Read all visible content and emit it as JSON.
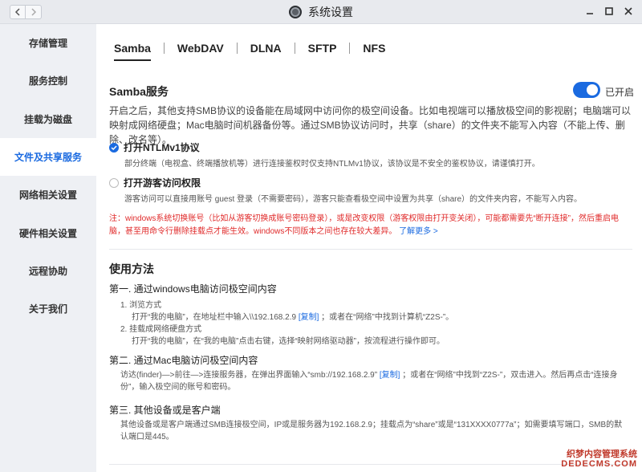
{
  "window": {
    "title": "系统设置"
  },
  "sidebar": {
    "items": [
      {
        "label": "存储管理"
      },
      {
        "label": "服务控制"
      },
      {
        "label": "挂载为磁盘"
      },
      {
        "label": "文件及共享服务"
      },
      {
        "label": "网络相关设置"
      },
      {
        "label": "硬件相关设置"
      },
      {
        "label": "远程协助"
      },
      {
        "label": "关于我们"
      }
    ],
    "active_index": 3
  },
  "tabs": [
    {
      "label": "Samba"
    },
    {
      "label": "WebDAV"
    },
    {
      "label": "DLNA"
    },
    {
      "label": "SFTP"
    },
    {
      "label": "NFS"
    }
  ],
  "samba": {
    "title": "Samba服务",
    "toggle_label": "已开启",
    "toggle_on": true,
    "description": "开启之后，其他支持SMB协议的设备能在局域网中访问你的极空间设备。比如电视端可以播放极空间的影视剧；电脑端可以映射成网络硬盘；Mac电脑时间机器备份等。通过SMB协议访问时，共享（share）的文件夹不能写入内容（不能上传、删除、改名等）。",
    "ntlm": {
      "label": "打开NTLMv1协议",
      "checked": true,
      "desc": "部分终端（电视盒、终端播放机等）进行连接鉴权时仅支持NTLMv1协议，该协议是不安全的鉴权协议，请谨慎打开。"
    },
    "guest": {
      "label": "打开游客访问权限",
      "checked": false,
      "desc": "游客访问可以直接用账号 guest 登录（不需要密码），游客只能查看极空间中设置为共享（share）的文件夹内容，不能写入内容。"
    },
    "warning": "注：windows系统切换账号（比如从游客切换成账号密码登录），或是改变权限（游客权限由打开变关闭），可能都需要先“断开连接”，然后重启电脑，甚至用命令行删除挂载点才能生效。windows不同版本之间也存在较大差异。",
    "learn_more": "了解更多 >"
  },
  "usage": {
    "title": "使用方法",
    "step1": {
      "title": "第一. 通过windows电脑访问极空间内容",
      "l1": "1. 浏览方式",
      "l2a": "打开“我的电脑”，在地址栏中输入\\\\192.168.2.9",
      "copy": "[复制]",
      "l2b": "；或者在“网络”中找到计算机“Z2S-”。",
      "l3": "2. 挂载成网络硬盘方式",
      "l4": "打开“我的电脑”，在“我的电脑”点击右键，选择“映射网络驱动器”，按流程进行操作即可。"
    },
    "step2": {
      "title": "第二. 通过Mac电脑访问极空间内容",
      "l1a": "访达(finder)—>前往—>连接服务器，在弹出界面输入“smb://192.168.2.9”",
      "copy": "[复制]",
      "l1b": "；或者在“网络”中找到“Z2S-”，双击进入。然后再点击“连接身份”，输入极空间的账号和密码。"
    },
    "step3": {
      "title": "第三. 其他设备或是客户端",
      "l1": "其他设备或是客户端通过SMB连接极空间，IP或是服务器为192.168.2.9；挂载点为“share”或是“131XXXX0777a”；如需要填写端口，SMB的默认端口是445。"
    }
  },
  "watermark": {
    "line1": "织梦内容管理系统",
    "line2": "DEDECMS.COM"
  },
  "colors": {
    "accent": "#1a6ae0",
    "warning": "#e02a2a"
  }
}
